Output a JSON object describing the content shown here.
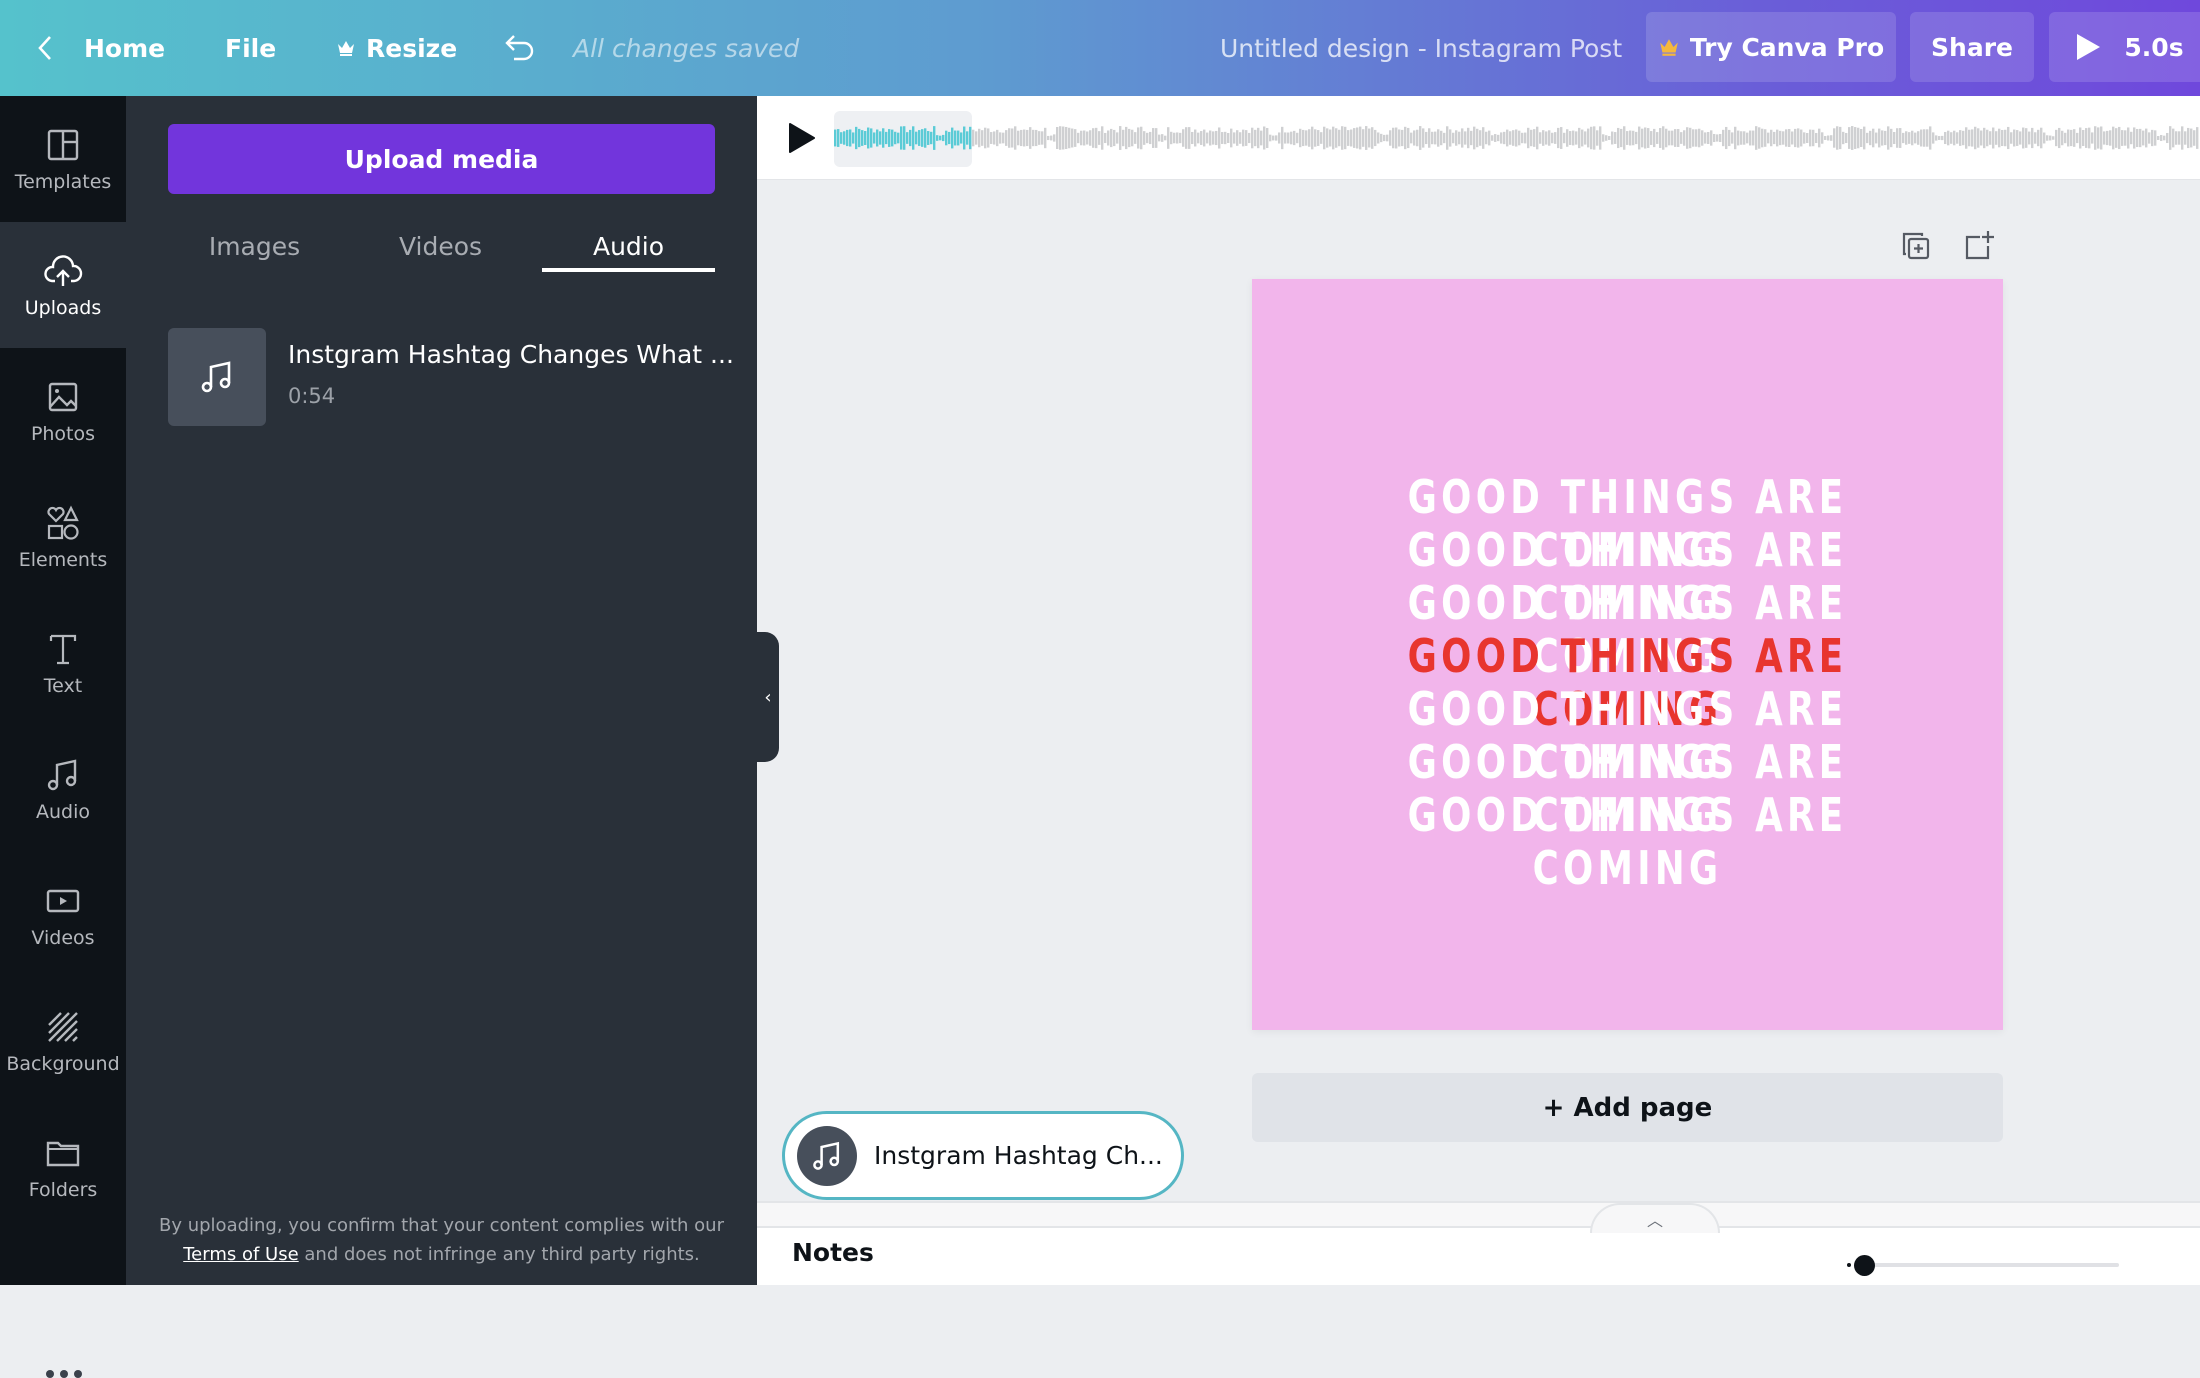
{
  "topbar": {
    "home_label": "Home",
    "file_label": "File",
    "resize_label": "Resize",
    "save_status": "All changes saved",
    "design_title": "Untitled design - Instagram Post",
    "try_pro_label": "Try Canva Pro",
    "share_label": "Share",
    "play_duration": "5.0s",
    "crown_color": "#f5b83d"
  },
  "sidebar": {
    "items": [
      {
        "label": "Templates",
        "icon": "templates-icon"
      },
      {
        "label": "Uploads",
        "icon": "upload-cloud-icon",
        "active": true
      },
      {
        "label": "Photos",
        "icon": "image-icon"
      },
      {
        "label": "Elements",
        "icon": "shapes-icon"
      },
      {
        "label": "Text",
        "icon": "text-icon"
      },
      {
        "label": "Audio",
        "icon": "music-note-icon"
      },
      {
        "label": "Videos",
        "icon": "video-icon"
      },
      {
        "label": "Background",
        "icon": "hatch-pattern-icon"
      },
      {
        "label": "Folders",
        "icon": "folder-icon"
      }
    ]
  },
  "panel": {
    "upload_label": "Upload media",
    "tabs": [
      {
        "label": "Images"
      },
      {
        "label": "Videos"
      },
      {
        "label": "Audio",
        "active": true
      }
    ],
    "audio_items": [
      {
        "title": "Instgram Hashtag Changes What ...",
        "duration": "0:54"
      }
    ],
    "legal_prefix": "By uploading, you confirm that your content complies with our",
    "legal_link": "Terms of Use",
    "legal_suffix": " and does not infringe any third party rights."
  },
  "editor": {
    "design_lines": [
      "GOOD THINGS ARE COMING",
      "GOOD THINGS ARE COMING",
      "GOOD THINGS ARE COMING",
      "GOOD THINGS ARE COMING",
      "GOOD THINGS ARE COMING",
      "GOOD THINGS ARE COMING",
      "GOOD THINGS ARE COMING"
    ],
    "highlight_line_index": 3,
    "canvas_color": "#f2b5eb",
    "highlight_color": "#e8352e",
    "add_page_label": "+ Add page",
    "audio_pill_label": "Instgram Hashtag Ch...",
    "waveform_color_selected": "#5bcbd6",
    "waveform_color": "#cfd0d2",
    "waveform_selected_fraction": 0.1
  },
  "footer": {
    "notes_label": "Notes",
    "zoom_fraction": 0.02
  }
}
